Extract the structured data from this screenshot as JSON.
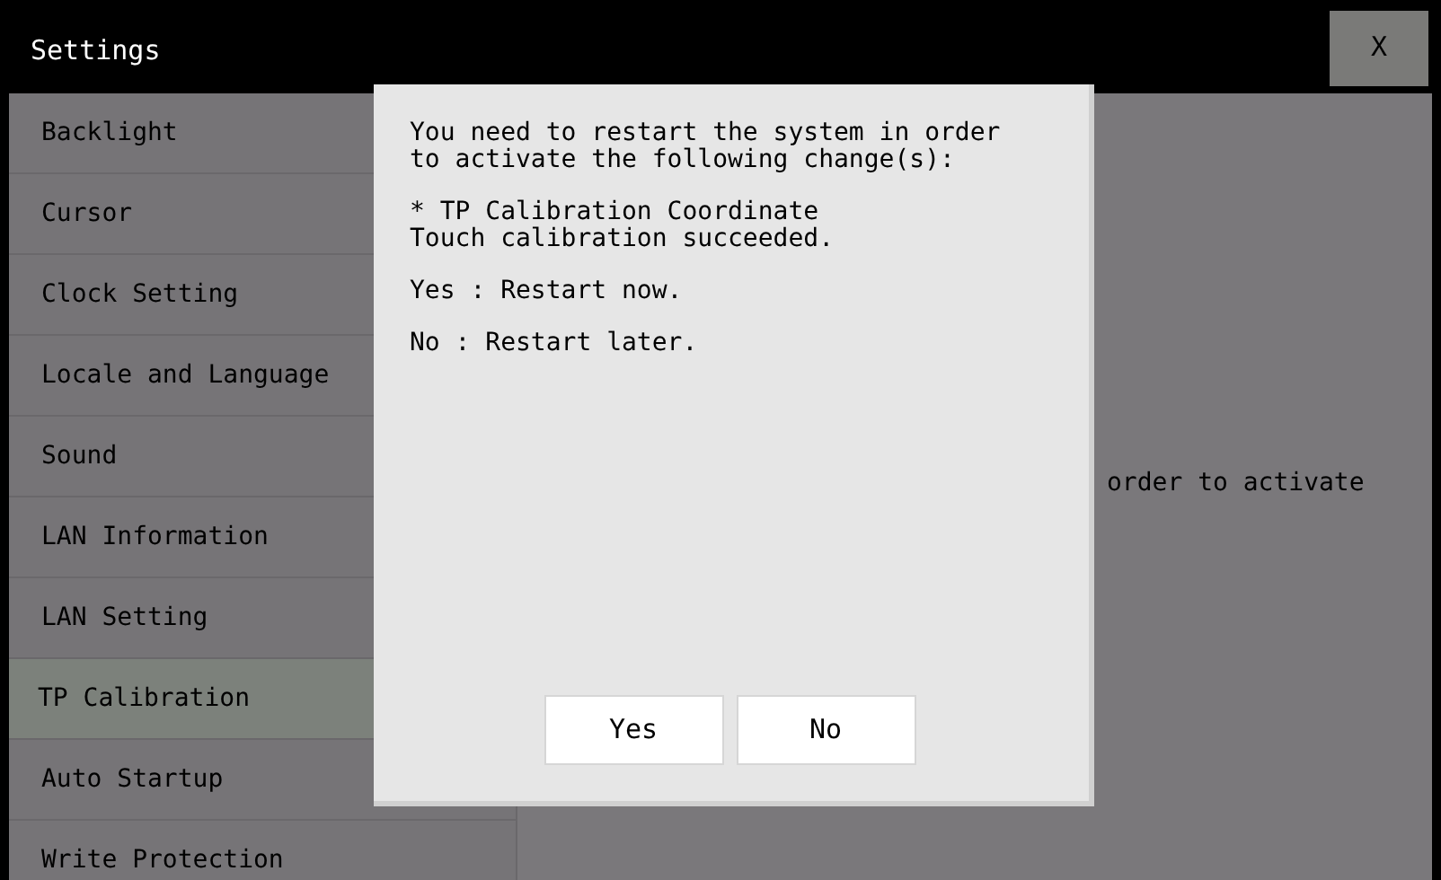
{
  "window": {
    "title": "Settings",
    "close_label": "X"
  },
  "sidebar": {
    "items": [
      {
        "label": "Backlight",
        "selected": false
      },
      {
        "label": "Cursor",
        "selected": false
      },
      {
        "label": "Clock Setting",
        "selected": false
      },
      {
        "label": "Locale and Language",
        "selected": false
      },
      {
        "label": "Sound",
        "selected": false
      },
      {
        "label": "LAN Information",
        "selected": false
      },
      {
        "label": "LAN Setting",
        "selected": false
      },
      {
        "label": "TP Calibration",
        "selected": true
      },
      {
        "label": "Auto Startup",
        "selected": false
      },
      {
        "label": "Write Protection",
        "selected": false
      }
    ]
  },
  "content": {
    "text": "order to activate"
  },
  "dialog": {
    "paragraphs": [
      "You need to restart the system in order\nto activate the following change(s):",
      "* TP Calibration Coordinate\nTouch calibration succeeded.",
      "Yes : Restart now.",
      "No : Restart later."
    ],
    "buttons": [
      "Yes",
      "No"
    ]
  }
}
